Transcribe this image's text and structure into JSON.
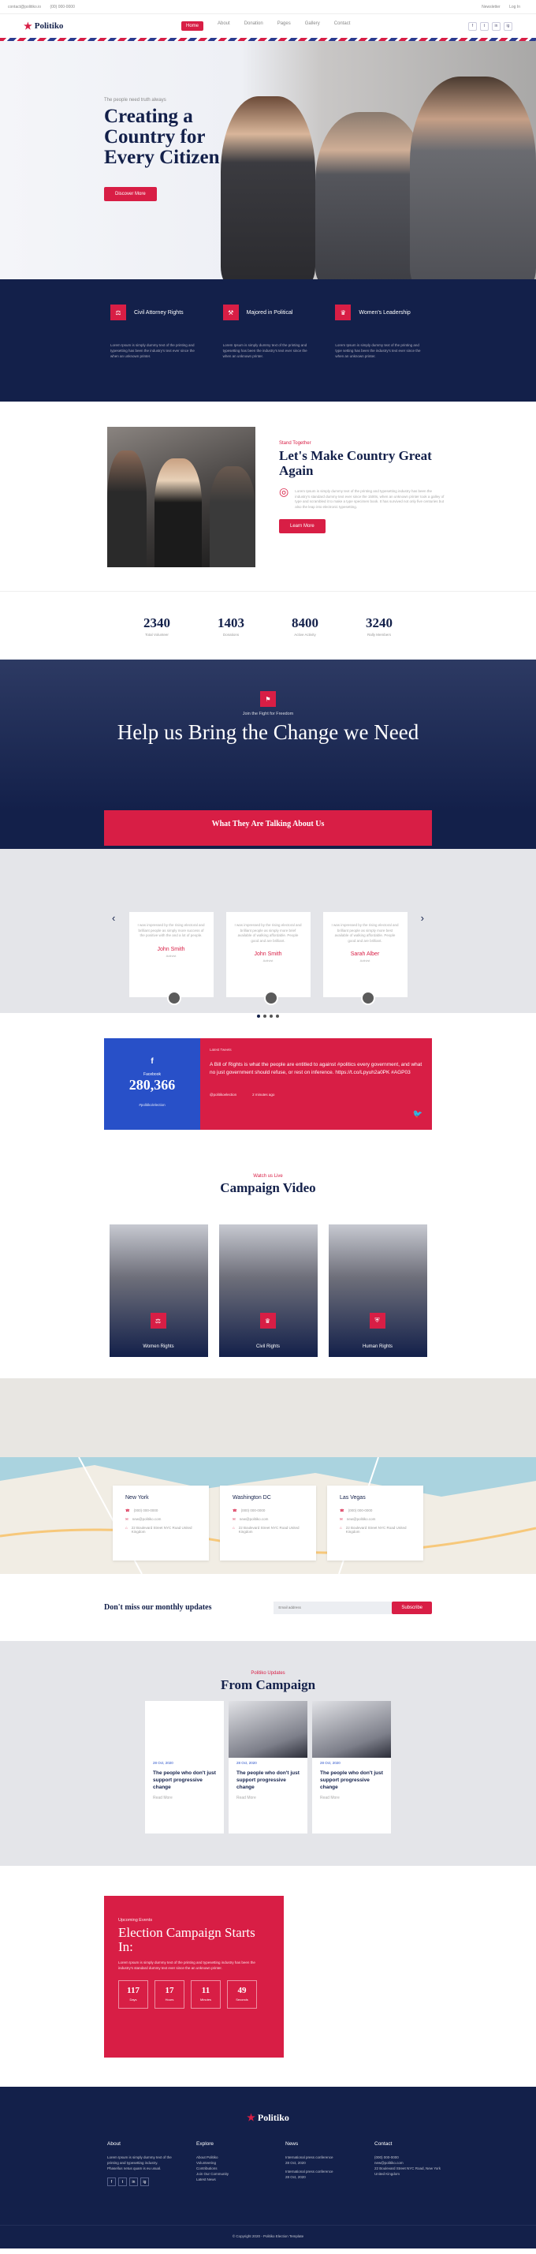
{
  "topbar": {
    "email": "contact@politiko.io",
    "phone": "(00) 000-0000",
    "newsletter": "Newsletter",
    "login": "Log In"
  },
  "nav": {
    "logo": "Politiko",
    "items": [
      "Home",
      "About",
      "Donation",
      "Pages",
      "Gallery",
      "Contact"
    ],
    "socials": [
      "f",
      "t",
      "in",
      "ig"
    ]
  },
  "hero": {
    "kicker": "The people need truth always",
    "title": "Creating a Country for Every Citizen",
    "button": "Discover More"
  },
  "features": [
    {
      "title": "Civil Attorney Rights",
      "text": "Lorem Ipsum is simply dummy text of the printing and typesetting has been the industry's text ever since the when an unknown printer."
    },
    {
      "title": "Majored in Political",
      "text": "Lorem Ipsum is simply dummy text of the printing and typesetting has been the industry's text ever since the when an unknown printer."
    },
    {
      "title": "Women's Leadership",
      "text": "Lorem Ipsum is simply dummy text of the printing and type setting has been the industry's text ever since the when an unknown printer."
    }
  ],
  "about": {
    "kicker": "Stand Together",
    "title": "Let's Make Country Great Again",
    "text": "Lorem Ipsum is simply dummy text of the printing and typesetting industry has been the industry's standard dummy text ever since the 1500s, when an unknown printer took a galley of type and scrambled it to make a type specimen book. It has survived not only five centuries but also the leap into electronic typesetting.",
    "button": "Learn More"
  },
  "stats": [
    {
      "value": "2340",
      "label": "Total Volunteer"
    },
    {
      "value": "1403",
      "label": "Donations"
    },
    {
      "value": "8400",
      "label": "Active Activity"
    },
    {
      "value": "3240",
      "label": "Rally Members"
    }
  ],
  "change": {
    "kicker": "Join the Fight for Freedom",
    "title": "Help us Bring the Change we Need",
    "talk_title": "What They Are Talking About Us"
  },
  "testimonials": [
    {
      "text": "I was impressed by the rising electoral and brilliant people as simply more success of the positive with the and a lot of people.",
      "name": "John Smith",
      "role": "Activist"
    },
    {
      "text": "I was impressed by the rising electoral and brilliant people as simply more brief available of walking affordable. People good and are brilliant.",
      "name": "John Smith",
      "role": "Activist"
    },
    {
      "text": "I was impressed by the rising electoral and brilliant people as simply more best available of walking affordable. People good and are brilliant.",
      "name": "Sarah Alber",
      "role": "Activist"
    }
  ],
  "social": {
    "fb_label": "Facebook",
    "fb_count": "280,366",
    "fb_tag": "#politiko/election",
    "tw_head": "Latest Tweets",
    "tw_body": "A Bill of Rights is what the people are entitled to against #politics every government, and what no just government should refuse, or rest on inference. https://t.co/Lpyuh2a0PK #AGP03",
    "tw_user": "@politikoelection",
    "tw_time": "2 minutes ago"
  },
  "video": {
    "kicker": "Watch us Live",
    "title": "Campaign Video",
    "cards": [
      "Women Rights",
      "Civil Rights",
      "Human Rights"
    ]
  },
  "offices": [
    {
      "city": "New York",
      "phone": "(000) 000-0000",
      "email": "new@politiko.com",
      "address": "22 Boulevard Street NYC Road United Kingdom"
    },
    {
      "city": "Washington DC",
      "phone": "(000) 000-0000",
      "email": "new@politiko.com",
      "address": "22 Boulevard Street NYC Road United Kingdom"
    },
    {
      "city": "Las Vegas",
      "phone": "(000) 000-0000",
      "email": "new@politiko.com",
      "address": "22 Boulevard Street NYC Road United Kingdom"
    }
  ],
  "newsletter": {
    "title": "Don't miss our monthly updates",
    "placeholder": "Email address",
    "button": "Subscribe"
  },
  "blog": {
    "kicker": "Politiko Updates",
    "title": "From Campaign",
    "posts": [
      {
        "date": "28 Oct, 2020",
        "title": "The people who don't just support progressive change",
        "more": "Read More"
      },
      {
        "date": "28 Oct, 2020",
        "title": "The people who don't just support progressive change",
        "more": "Read More"
      },
      {
        "date": "28 Oct, 2020",
        "title": "The people who don't just support progressive change",
        "more": "Read More"
      }
    ]
  },
  "election": {
    "kicker": "Upcoming Events",
    "title": "Election Campaign Starts In:",
    "text": "Lorem Ipsum is simply dummy text of the printing and typesetting industry has been the industry's standard dummy text ever since the an unknown printer.",
    "counter": [
      {
        "value": "117",
        "label": "Days"
      },
      {
        "value": "17",
        "label": "Hours"
      },
      {
        "value": "11",
        "label": "Minutes"
      },
      {
        "value": "49",
        "label": "Seconds"
      }
    ]
  },
  "footer": {
    "logo": "Politiko",
    "about_title": "About",
    "about_text": "Lorem Ipsum is simply dummy text of the printing and typesetting industry. Phasellus netus quam is eu usual.",
    "explore_title": "Explore",
    "explore_items": [
      "About Politiko",
      "Volunteering",
      "Contributions",
      "Join Our Community",
      "Latest News"
    ],
    "news_title": "News",
    "news_items": [
      "International press conference",
      "28 Oct, 2020",
      "International press conference",
      "28 Oct, 2020"
    ],
    "contact_title": "Contact",
    "contact_items": [
      "(000) 000-0000",
      "new@politiko.com",
      "22 Boulevard Street NYC Road, New York United Kingdom"
    ],
    "copyright": "© Copyright 2020 - Politiko Election Template"
  }
}
